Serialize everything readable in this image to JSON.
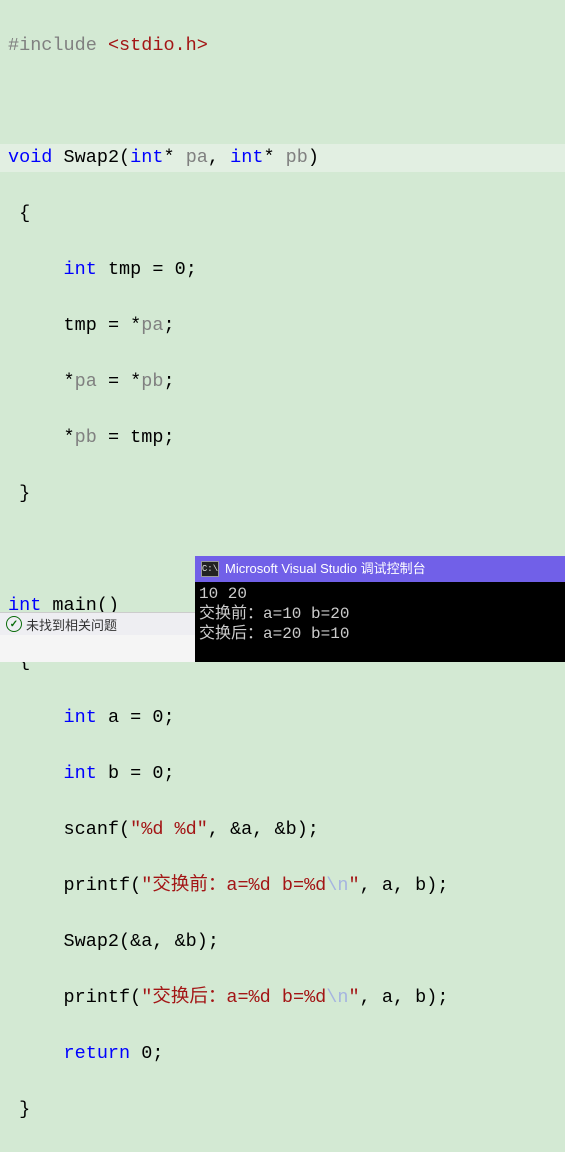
{
  "code": {
    "include_directive": "#include",
    "include_file": "<stdio.h>",
    "swap_fn": {
      "ret": "void",
      "name": "Swap2",
      "param1_type": "int",
      "param1_name": "pa",
      "param2_type": "int",
      "param2_name": "pb",
      "tmp_decl_type": "int",
      "tmp_decl_name": "tmp",
      "tmp_decl_val": "0",
      "l1_lhs": "tmp",
      "l1_rhs": "pa",
      "l2_lhs": "pa",
      "l2_rhs": "pb",
      "l3_lhs": "pb",
      "l3_rhs": "tmp"
    },
    "main_fn": {
      "ret": "int",
      "name": "main",
      "a_type": "int",
      "a_name": "a",
      "a_val": "0",
      "b_type": "int",
      "b_name": "b",
      "b_val": "0",
      "scanf_name": "scanf",
      "scanf_fmt": "\"%d %d\"",
      "scanf_arg1": "a",
      "scanf_arg2": "b",
      "printf1_name": "printf",
      "printf1_fmt_a": "\"交换前：a=%d b=%d",
      "printf1_esc": "\\n",
      "printf1_fmt_b": "\"",
      "printf1_arg1": "a",
      "printf1_arg2": "b",
      "swap_call": "Swap2",
      "swap_arg1": "a",
      "swap_arg2": "b",
      "printf2_name": "printf",
      "printf2_fmt_a": "\"交换后：a=%d b=%d",
      "printf2_esc": "\\n",
      "printf2_fmt_b": "\"",
      "printf2_arg1": "a",
      "printf2_arg2": "b",
      "return_kw": "return",
      "return_val": "0"
    }
  },
  "status": {
    "text": "未找到相关问题"
  },
  "console": {
    "title": "Microsoft Visual Studio 调试控制台",
    "line1": "10 20",
    "line2": "交换前：a=10 b=20",
    "line3": "交换后：a=20 b=10"
  }
}
